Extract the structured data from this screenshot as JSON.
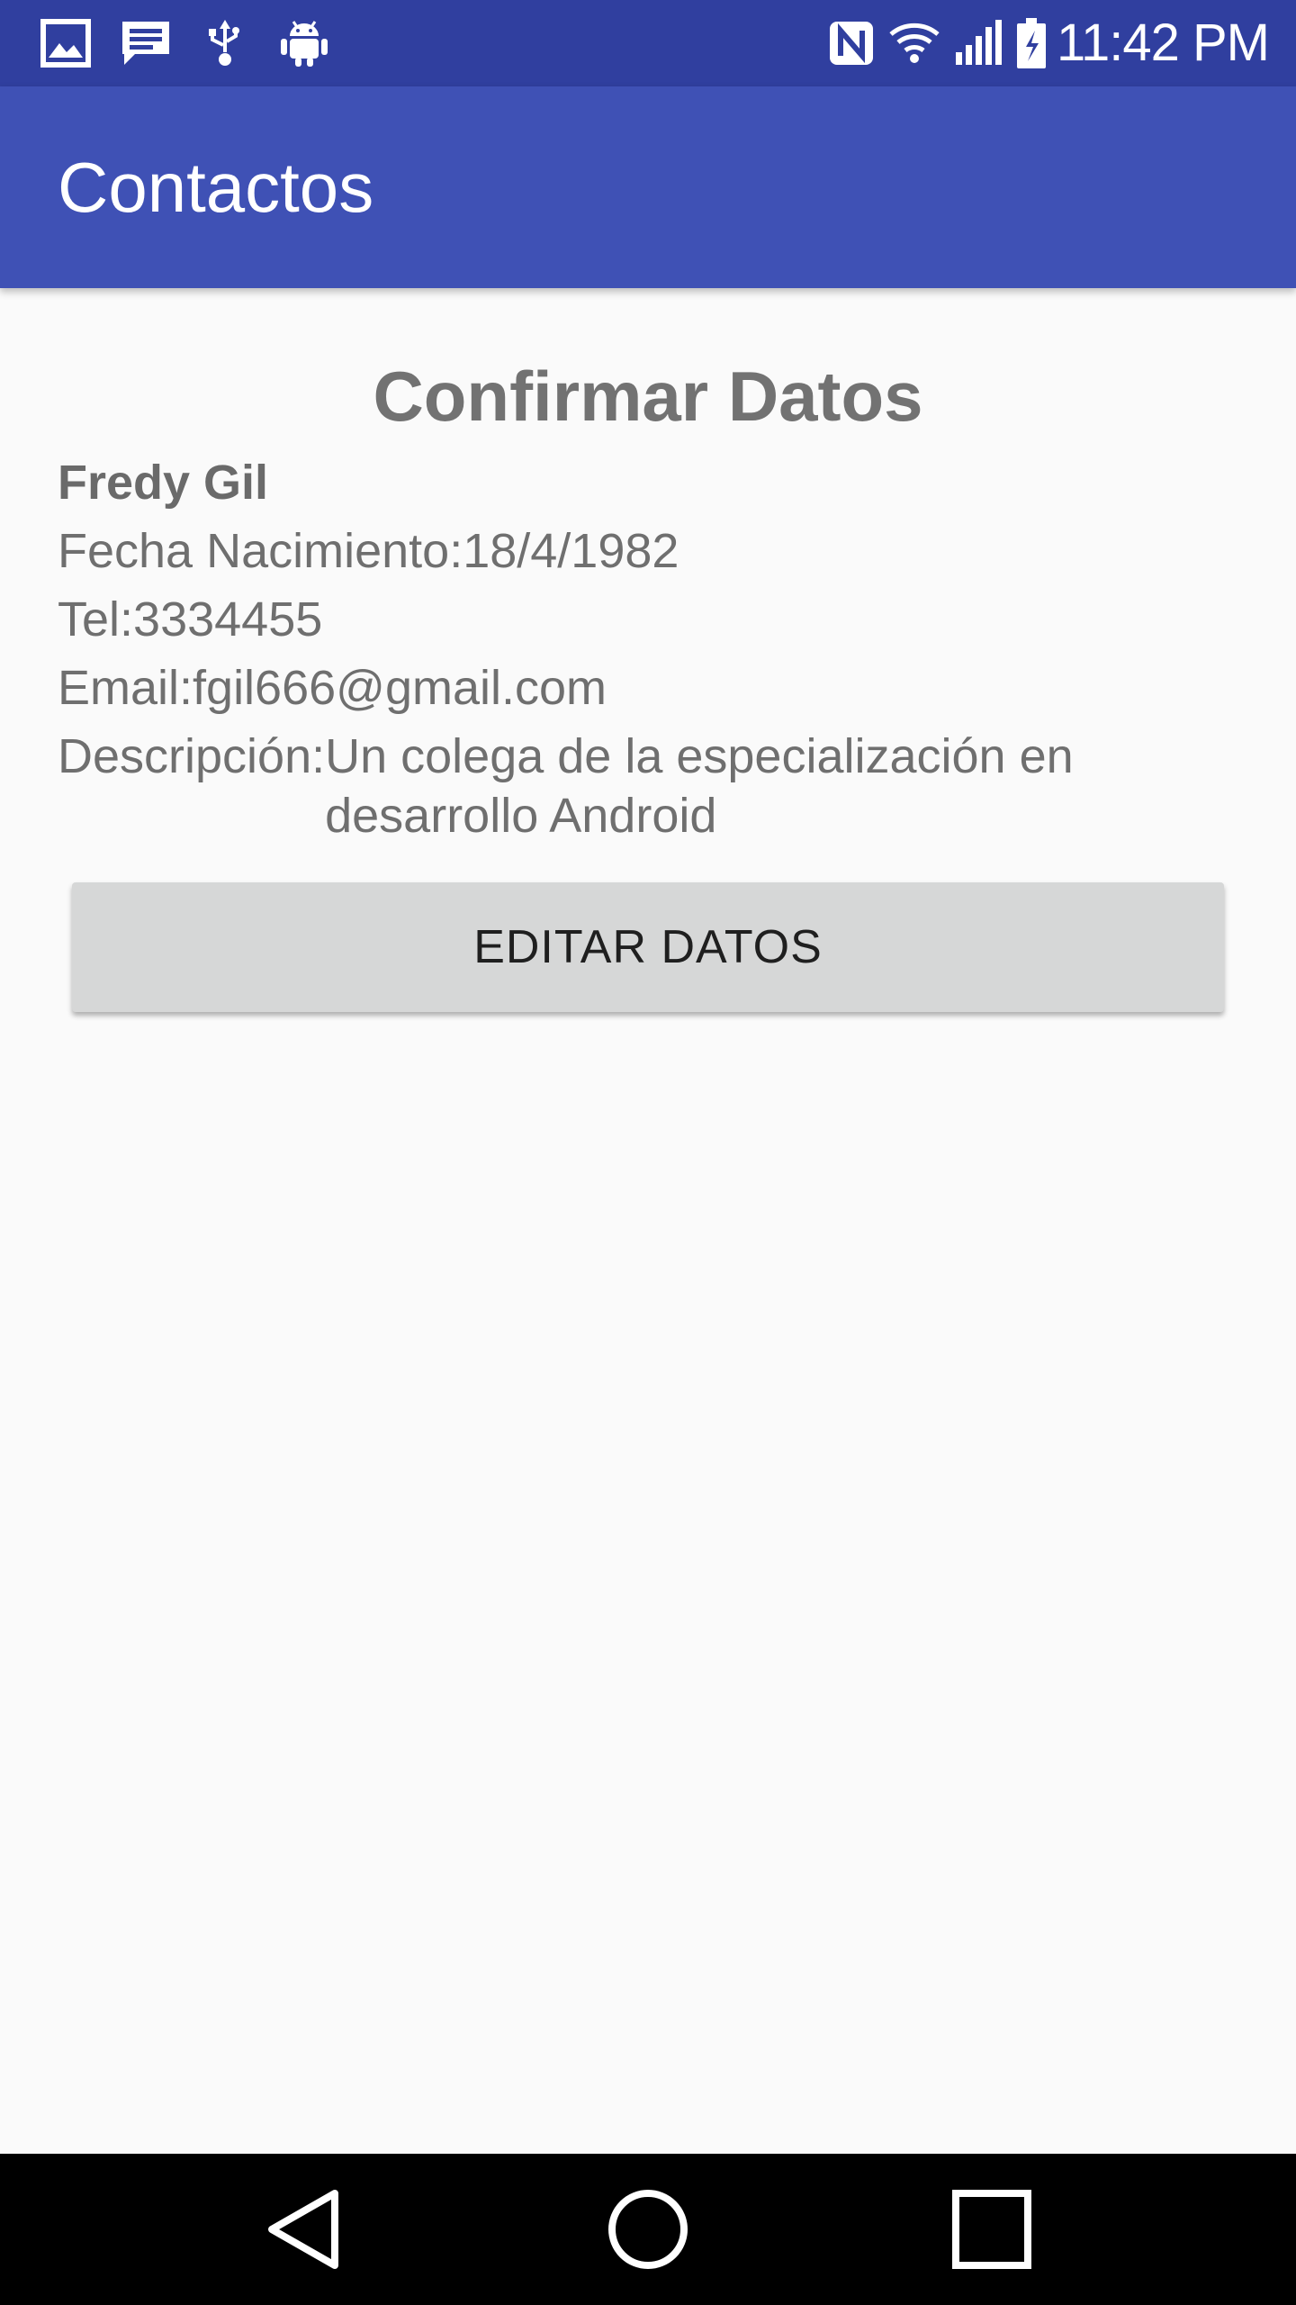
{
  "status_bar": {
    "left_icons": [
      "image-icon",
      "message-icon",
      "usb-icon",
      "android-debug-icon"
    ],
    "right_icons": [
      "nfc-icon",
      "wifi-icon",
      "signal-icon",
      "battery-charging-icon"
    ],
    "time": "11:42 PM"
  },
  "app_bar": {
    "title": "Contactos"
  },
  "main": {
    "heading": "Confirmar Datos",
    "name": "Fredy Gil",
    "birth_date": "Fecha Nacimiento:18/4/1982",
    "phone": "Tel:3334455",
    "email": "Email:fgil666@gmail.com",
    "description_label": "Descripción:",
    "description_value": "Un colega de la especialización en desarrollo Android",
    "edit_button": "EDITAR DATOS"
  },
  "nav_bar": {
    "icons": [
      "back-icon",
      "home-icon",
      "recents-icon"
    ]
  },
  "colors": {
    "status_bar": "#303f9f",
    "app_bar": "#3f51b5",
    "background": "#fafafa",
    "text": "#6f6f6f",
    "button": "#d6d7d7"
  }
}
